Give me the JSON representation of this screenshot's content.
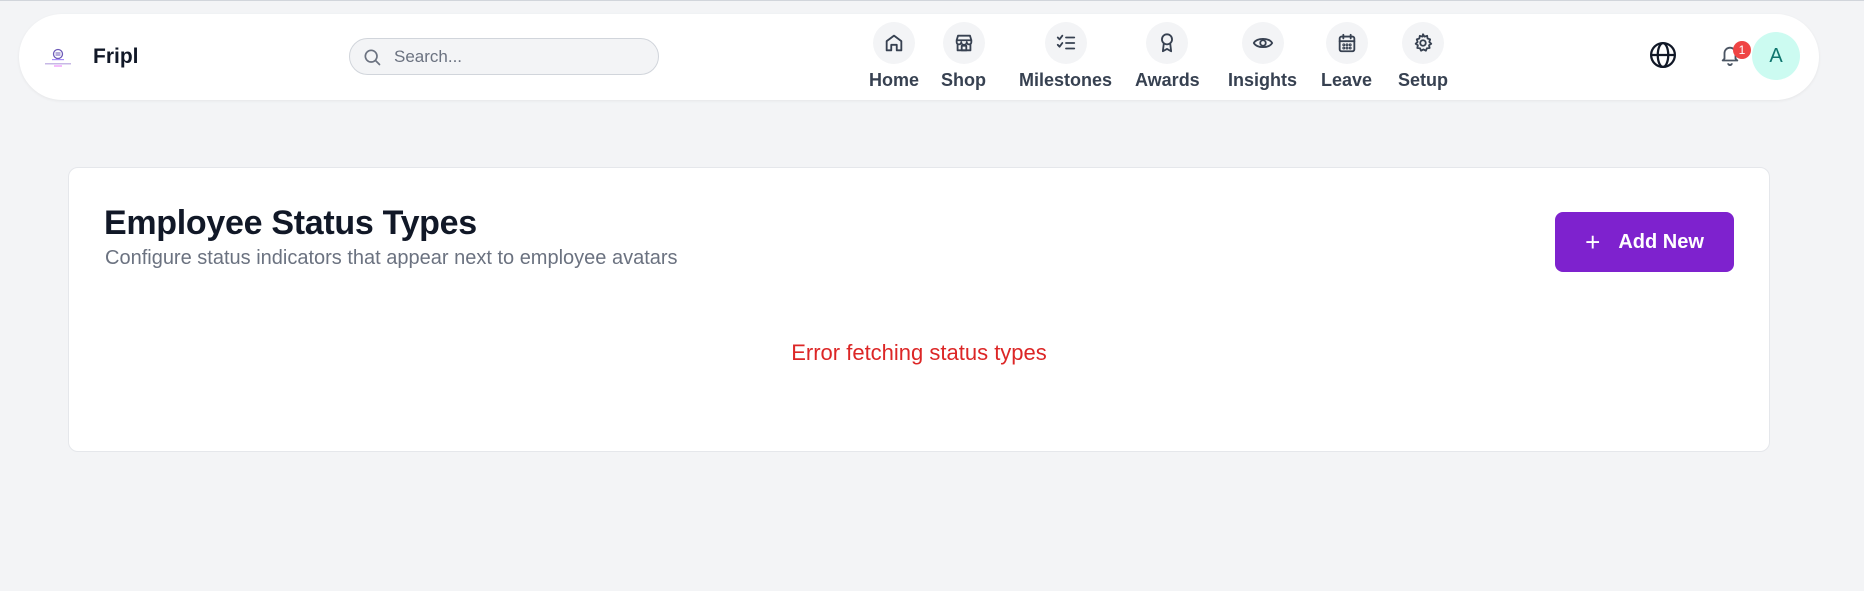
{
  "app": {
    "brand_name": "Fripl",
    "logo_icon": "company-logo"
  },
  "search": {
    "placeholder": "Search...",
    "value": ""
  },
  "nav": {
    "items": [
      {
        "label": "Home",
        "icon": "home-icon"
      },
      {
        "label": "Shop",
        "icon": "store-icon"
      },
      {
        "label": "Milestones",
        "icon": "checklist-icon"
      },
      {
        "label": "Awards",
        "icon": "award-icon"
      },
      {
        "label": "Insights",
        "icon": "eye-icon"
      },
      {
        "label": "Leave",
        "icon": "calendar-icon"
      },
      {
        "label": "Setup",
        "icon": "gear-icon"
      }
    ]
  },
  "header_right": {
    "language_icon": "globe-icon",
    "notification_icon": "bell-icon",
    "notification_count": "1",
    "avatar_initial": "A"
  },
  "page": {
    "title": "Employee Status Types",
    "subtitle": "Configure status indicators that appear next to employee avatars",
    "add_button_label": "Add New",
    "error_message": "Error fetching status types"
  },
  "colors": {
    "primary": "#7e22ce",
    "error": "#dc2626",
    "badge": "#ef4444",
    "avatar_bg": "#ccfbf1",
    "background": "#f3f4f6"
  }
}
